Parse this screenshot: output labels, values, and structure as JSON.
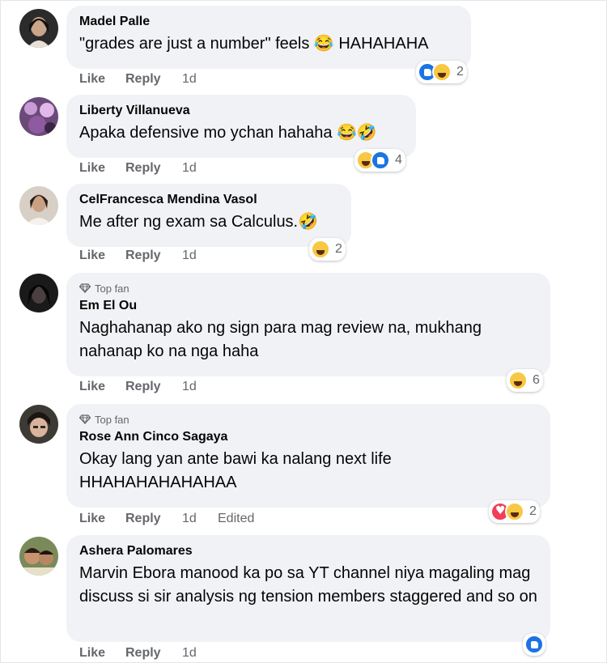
{
  "comments": [
    {
      "top_fan": "",
      "name": "Madel Palle",
      "text": "\"grades are just a number\" feels 😂 HAHAHAHA",
      "like": "Like",
      "reply": "Reply",
      "time": "1d",
      "edited": "",
      "reactions": [
        "like",
        "haha"
      ],
      "reaction_count": "2"
    },
    {
      "top_fan": "",
      "name": "Liberty Villanueva",
      "text": "Apaka defensive mo ychan hahaha 😂🤣",
      "like": "Like",
      "reply": "Reply",
      "time": "1d",
      "edited": "",
      "reactions": [
        "haha",
        "like"
      ],
      "reaction_count": "4"
    },
    {
      "top_fan": "",
      "name": "CelFrancesca Mendina Vasol",
      "text": "Me after ng exam sa Calculus.🤣",
      "like": "Like",
      "reply": "Reply",
      "time": "1d",
      "edited": "",
      "reactions": [
        "haha"
      ],
      "reaction_count": "2"
    },
    {
      "top_fan": "Top fan",
      "name": "Em El Ou",
      "text": "Naghahanap ako ng sign para mag review na, mukhang nahanap ko na nga haha",
      "like": "Like",
      "reply": "Reply",
      "time": "1d",
      "edited": "",
      "reactions": [
        "haha"
      ],
      "reaction_count": "6"
    },
    {
      "top_fan": "Top fan",
      "name": "Rose Ann Cinco Sagaya",
      "text": "Okay lang yan ante bawi ka nalang next life HHAHAHAHAHAHAA",
      "like": "Like",
      "reply": "Reply",
      "time": "1d",
      "edited": "Edited",
      "reactions": [
        "love",
        "haha"
      ],
      "reaction_count": "2"
    },
    {
      "top_fan": "",
      "name": "Ashera Palomares",
      "text": "Marvin Ebora manood ka po sa YT channel niya magaling mag discuss si sir analysis ng tension members staggered and so on",
      "like": "Like",
      "reply": "Reply",
      "time": "1d",
      "edited": "",
      "reactions": [
        "like"
      ],
      "reaction_count": ""
    }
  ],
  "colors": {
    "bubble": "#f0f2f5",
    "secondary_text": "#65676b",
    "like_blue": "#1b74e4",
    "haha_yellow": "#f7c844",
    "love_red": "#f33e58"
  }
}
